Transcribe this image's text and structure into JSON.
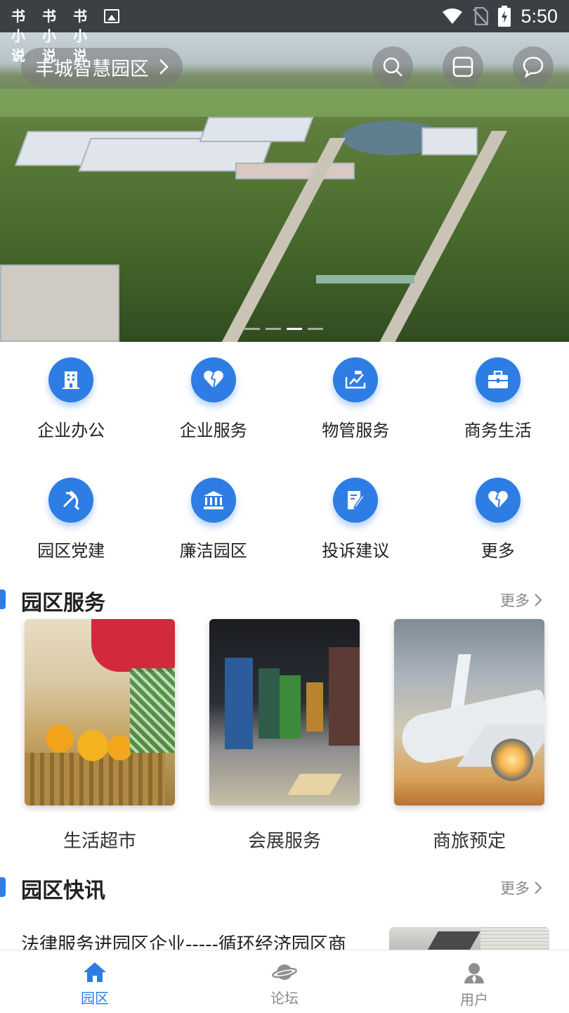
{
  "status_bar": {
    "app_icons": [
      "书小说",
      "书小说",
      "书小说"
    ],
    "time": "5:50"
  },
  "banner": {
    "park_name": "丰城智慧园区",
    "slide_count": 4,
    "active_slide": 3
  },
  "quick_menu": [
    {
      "label": "企业办公",
      "icon": "building-icon"
    },
    {
      "label": "企业服务",
      "icon": "heart-icon"
    },
    {
      "label": "物管服务",
      "icon": "property-icon"
    },
    {
      "label": "商务生活",
      "icon": "briefcase-icon"
    },
    {
      "label": "园区党建",
      "icon": "hammer-sickle-icon"
    },
    {
      "label": "廉洁园区",
      "icon": "bank-icon"
    },
    {
      "label": "投诉建议",
      "icon": "feedback-icon"
    },
    {
      "label": "更多",
      "icon": "heart-icon"
    }
  ],
  "park_services": {
    "title": "园区服务",
    "more": "更多",
    "items": [
      {
        "label": "生活超市"
      },
      {
        "label": "会展服务"
      },
      {
        "label": "商旅预定"
      }
    ]
  },
  "park_news": {
    "title": "园区快讯",
    "more": "更多",
    "items": [
      {
        "title": "法律服务进园区企业-----循环经济园区商"
      }
    ]
  },
  "tab_bar": {
    "tabs": [
      {
        "label": "园区",
        "icon": "home-icon",
        "active": true
      },
      {
        "label": "论坛",
        "icon": "planet-icon",
        "active": false
      },
      {
        "label": "用户",
        "icon": "user-icon",
        "active": false
      }
    ]
  },
  "colors": {
    "accent": "#2e7de4",
    "status_bar": "#3b4045"
  }
}
